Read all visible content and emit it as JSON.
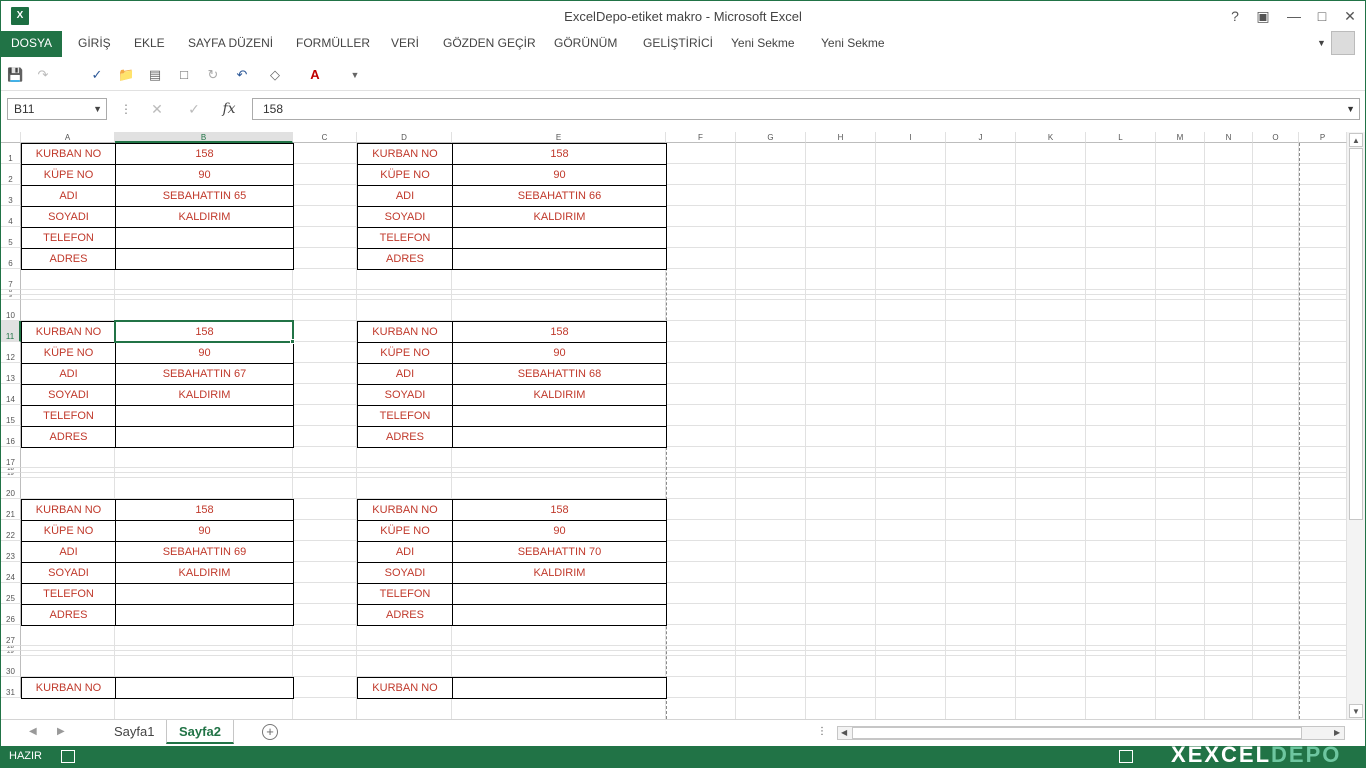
{
  "window": {
    "title": "ExcelDepo-etiket makro - Microsoft Excel",
    "help": "?",
    "logo": "X"
  },
  "ribbon": {
    "tabs": [
      "DOSYA",
      "GİRİŞ",
      "EKLE",
      "SAYFA DÜZENİ",
      "FORMÜLLER",
      "VERİ",
      "GÖZDEN GEÇİR",
      "GÖRÜNÜM",
      "GELİŞTİRİCİ",
      "Yeni Sekme",
      "Yeni Sekme"
    ]
  },
  "formula_bar": {
    "name_box": "B11",
    "fx": "fx",
    "value": "158"
  },
  "columns": [
    "A",
    "B",
    "C",
    "D",
    "E",
    "F",
    "G",
    "H",
    "I",
    "J",
    "K",
    "L",
    "M",
    "N",
    "O",
    "P"
  ],
  "rows": [
    "1",
    "2",
    "3",
    "4",
    "5",
    "6",
    "7",
    "8",
    "9",
    "10",
    "11",
    "12",
    "13",
    "14",
    "15",
    "16",
    "17",
    "18",
    "19",
    "20",
    "21",
    "22",
    "23",
    "24",
    "25",
    "26",
    "27",
    "28",
    "29",
    "30",
    "31"
  ],
  "labels": [
    "KURBAN NO",
    "KÜPE NO",
    "ADI",
    "SOYADI",
    "TELEFON",
    "ADRES"
  ],
  "blocks": [
    {
      "kurban": "158",
      "kupe": "90",
      "adi": "SEBAHATTIN 65",
      "soyadi": "KALDIRIM"
    },
    {
      "kurban": "158",
      "kupe": "90",
      "adi": "SEBAHATTIN 66",
      "soyadi": "KALDIRIM"
    },
    {
      "kurban": "158",
      "kupe": "90",
      "adi": "SEBAHATTIN 67",
      "soyadi": "KALDIRIM"
    },
    {
      "kurban": "158",
      "kupe": "90",
      "adi": "SEBAHATTIN 68",
      "soyadi": "KALDIRIM"
    },
    {
      "kurban": "158",
      "kupe": "90",
      "adi": "SEBAHATTIN 69",
      "soyadi": "KALDIRIM"
    },
    {
      "kurban": "158",
      "kupe": "90",
      "adi": "SEBAHATTIN 70",
      "soyadi": "KALDIRIM"
    }
  ],
  "partial_row_label": "KURBAN NO",
  "sheets": {
    "tabs": [
      "Sayfa1",
      "Sayfa2"
    ],
    "active": "Sayfa2",
    "add": "+"
  },
  "status": {
    "mode": "HAZIR",
    "brand_a": "EXCEL",
    "brand_b": "DEPO",
    "brand_prefix": "X"
  },
  "colors": {
    "accent": "#217346",
    "cell_text": "#c0392b"
  }
}
